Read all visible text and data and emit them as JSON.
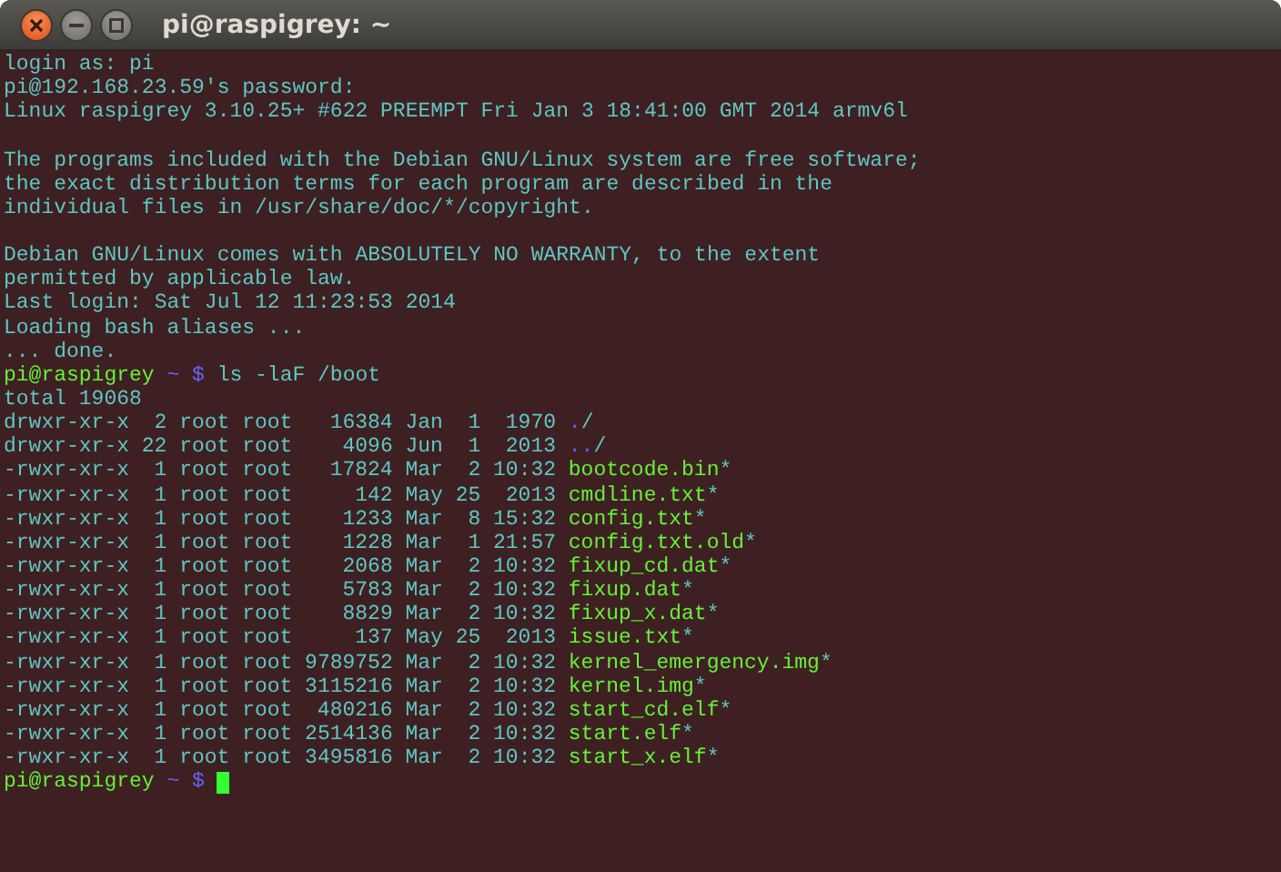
{
  "window": {
    "title": "pi@raspigrey: ~"
  },
  "lines": [
    {
      "kind": "text",
      "text": "login as: pi"
    },
    {
      "kind": "text",
      "text": "pi@192.168.23.59's password:"
    },
    {
      "kind": "text",
      "text": "Linux raspigrey 3.10.25+ #622 PREEMPT Fri Jan 3 18:41:00 GMT 2014 armv6l"
    },
    {
      "kind": "blank"
    },
    {
      "kind": "text",
      "text": "The programs included with the Debian GNU/Linux system are free software;"
    },
    {
      "kind": "text",
      "text": "the exact distribution terms for each program are described in the"
    },
    {
      "kind": "text",
      "text": "individual files in /usr/share/doc/*/copyright."
    },
    {
      "kind": "blank"
    },
    {
      "kind": "text",
      "text": "Debian GNU/Linux comes with ABSOLUTELY NO WARRANTY, to the extent"
    },
    {
      "kind": "text",
      "text": "permitted by applicable law."
    },
    {
      "kind": "text",
      "text": "Last login: Sat Jul 12 11:23:53 2014"
    },
    {
      "kind": "text",
      "text": "Loading bash aliases ..."
    },
    {
      "kind": "text",
      "text": "... done."
    },
    {
      "kind": "prompt",
      "user": "pi@raspigrey",
      "dir": "~",
      "sign": "$",
      "command": "ls -laF /boot",
      "cursor": false
    },
    {
      "kind": "text",
      "text": "total 19068"
    },
    {
      "kind": "listing",
      "perms": "drwxr-xr-x",
      "links": "2",
      "owner": "root",
      "group": "root",
      "size": "16384",
      "month": "Jan",
      "day": "1",
      "time": "1970",
      "color": "#5f5fff",
      "name": ".",
      "suffix": "/"
    },
    {
      "kind": "listing",
      "perms": "drwxr-xr-x",
      "links": "22",
      "owner": "root",
      "group": "root",
      "size": "4096",
      "month": "Jun",
      "day": "1",
      "time": "2013",
      "color": "#5f5fff",
      "name": "..",
      "suffix": "/"
    },
    {
      "kind": "listing",
      "perms": "-rwxr-xr-x",
      "links": "1",
      "owner": "root",
      "group": "root",
      "size": "17824",
      "month": "Mar",
      "day": "2",
      "time": "10:32",
      "color": "#66f03a",
      "name": "bootcode.bin",
      "suffix": "*"
    },
    {
      "kind": "listing",
      "perms": "-rwxr-xr-x",
      "links": "1",
      "owner": "root",
      "group": "root",
      "size": "142",
      "month": "May",
      "day": "25",
      "time": "2013",
      "color": "#66f03a",
      "name": "cmdline.txt",
      "suffix": "*"
    },
    {
      "kind": "listing",
      "perms": "-rwxr-xr-x",
      "links": "1",
      "owner": "root",
      "group": "root",
      "size": "1233",
      "month": "Mar",
      "day": "8",
      "time": "15:32",
      "color": "#66f03a",
      "name": "config.txt",
      "suffix": "*"
    },
    {
      "kind": "listing",
      "perms": "-rwxr-xr-x",
      "links": "1",
      "owner": "root",
      "group": "root",
      "size": "1228",
      "month": "Mar",
      "day": "1",
      "time": "21:57",
      "color": "#66f03a",
      "name": "config.txt.old",
      "suffix": "*"
    },
    {
      "kind": "listing",
      "perms": "-rwxr-xr-x",
      "links": "1",
      "owner": "root",
      "group": "root",
      "size": "2068",
      "month": "Mar",
      "day": "2",
      "time": "10:32",
      "color": "#66f03a",
      "name": "fixup_cd.dat",
      "suffix": "*"
    },
    {
      "kind": "listing",
      "perms": "-rwxr-xr-x",
      "links": "1",
      "owner": "root",
      "group": "root",
      "size": "5783",
      "month": "Mar",
      "day": "2",
      "time": "10:32",
      "color": "#66f03a",
      "name": "fixup.dat",
      "suffix": "*"
    },
    {
      "kind": "listing",
      "perms": "-rwxr-xr-x",
      "links": "1",
      "owner": "root",
      "group": "root",
      "size": "8829",
      "month": "Mar",
      "day": "2",
      "time": "10:32",
      "color": "#66f03a",
      "name": "fixup_x.dat",
      "suffix": "*"
    },
    {
      "kind": "listing",
      "perms": "-rwxr-xr-x",
      "links": "1",
      "owner": "root",
      "group": "root",
      "size": "137",
      "month": "May",
      "day": "25",
      "time": "2013",
      "color": "#66f03a",
      "name": "issue.txt",
      "suffix": "*"
    },
    {
      "kind": "listing",
      "perms": "-rwxr-xr-x",
      "links": "1",
      "owner": "root",
      "group": "root",
      "size": "9789752",
      "month": "Mar",
      "day": "2",
      "time": "10:32",
      "color": "#66f03a",
      "name": "kernel_emergency.img",
      "suffix": "*"
    },
    {
      "kind": "listing",
      "perms": "-rwxr-xr-x",
      "links": "1",
      "owner": "root",
      "group": "root",
      "size": "3115216",
      "month": "Mar",
      "day": "2",
      "time": "10:32",
      "color": "#66f03a",
      "name": "kernel.img",
      "suffix": "*"
    },
    {
      "kind": "listing",
      "perms": "-rwxr-xr-x",
      "links": "1",
      "owner": "root",
      "group": "root",
      "size": "480216",
      "month": "Mar",
      "day": "2",
      "time": "10:32",
      "color": "#66f03a",
      "name": "start_cd.elf",
      "suffix": "*"
    },
    {
      "kind": "listing",
      "perms": "-rwxr-xr-x",
      "links": "1",
      "owner": "root",
      "group": "root",
      "size": "2514136",
      "month": "Mar",
      "day": "2",
      "time": "10:32",
      "color": "#66f03a",
      "name": "start.elf",
      "suffix": "*"
    },
    {
      "kind": "listing",
      "perms": "-rwxr-xr-x",
      "links": "1",
      "owner": "root",
      "group": "root",
      "size": "3495816",
      "month": "Mar",
      "day": "2",
      "time": "10:32",
      "color": "#66f03a",
      "name": "start_x.elf",
      "suffix": "*"
    },
    {
      "kind": "prompt",
      "user": "pi@raspigrey",
      "dir": "~",
      "sign": "$",
      "cursor": true
    }
  ]
}
